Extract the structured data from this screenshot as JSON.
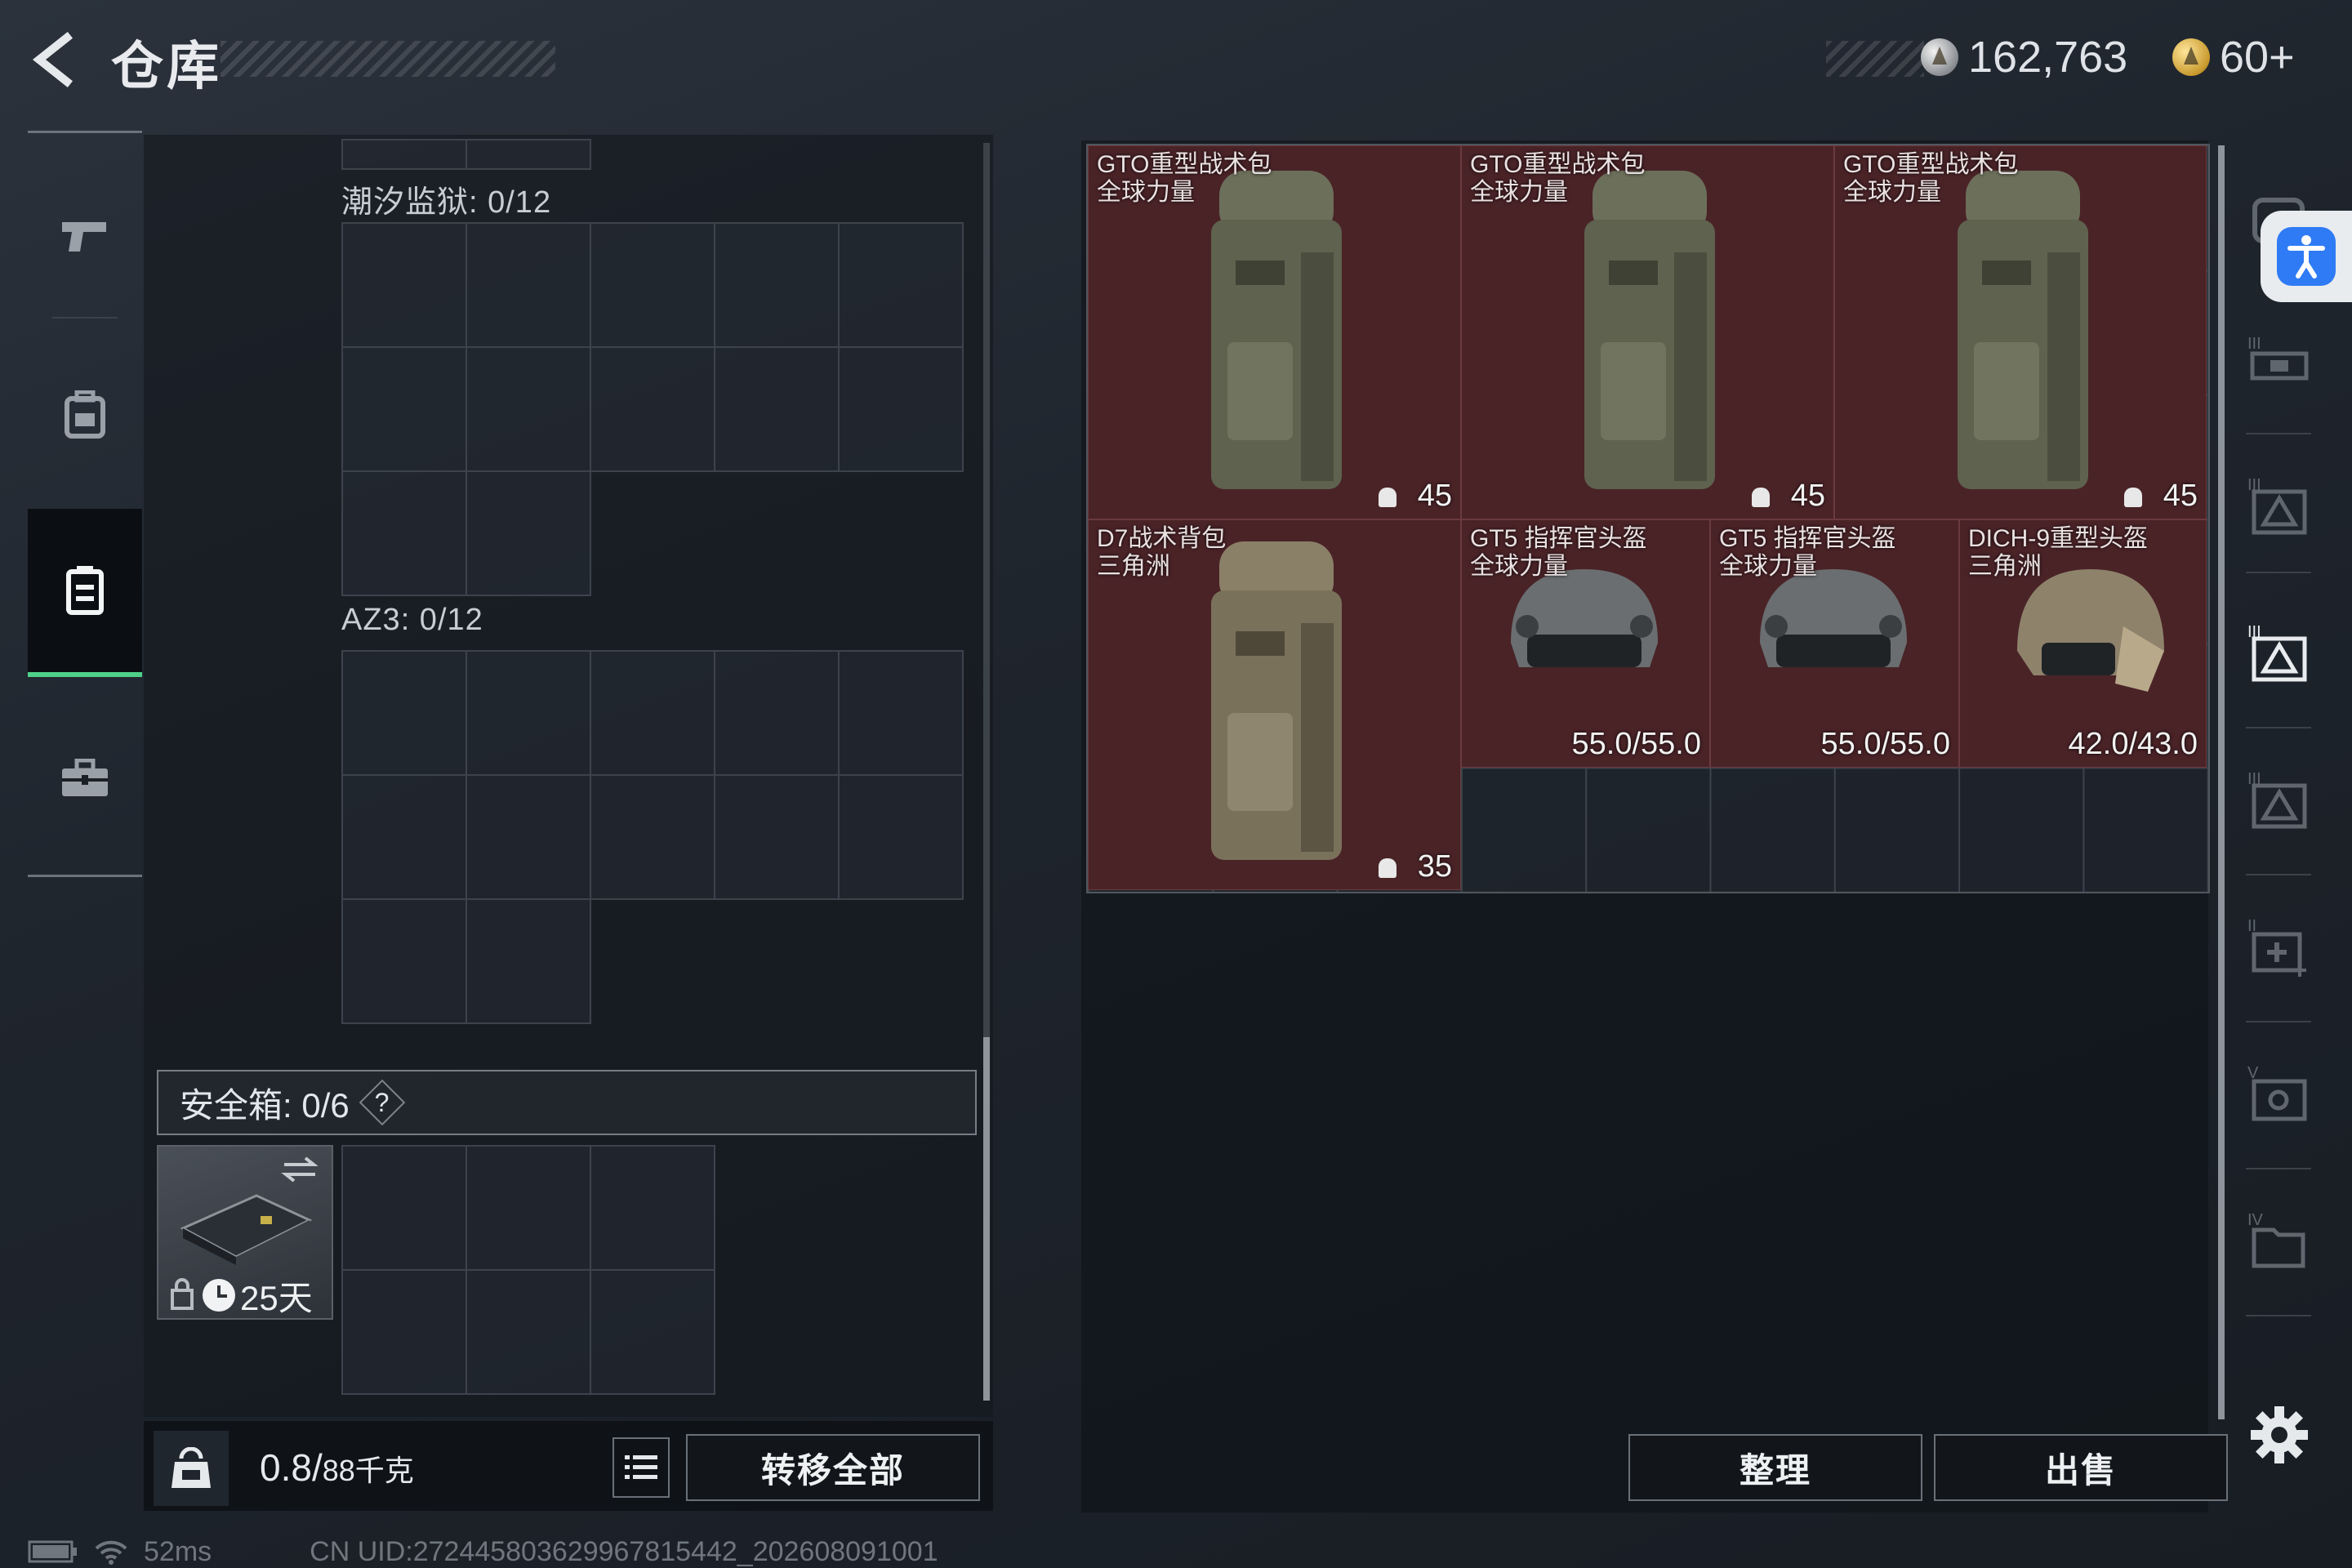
{
  "header": {
    "title": "仓库",
    "currency_silver": "162,763",
    "currency_gold": "60+"
  },
  "left_panel": {
    "section1_label": "潮汐监狱: 0/12",
    "section2_label": "AZ3: 0/12",
    "safebox_label": "安全箱:  0/6",
    "safebox_help": "?",
    "safe_item_days": "25天",
    "weight_value": "0.8/",
    "weight_unit": "88千克",
    "transfer_all": "转移全部"
  },
  "storage_items": [
    {
      "name": "GTO重型战术包\n全球力量",
      "value": "45"
    },
    {
      "name": "GTO重型战术包\n全球力量",
      "value": "45"
    },
    {
      "name": "GTO重型战术包\n全球力量",
      "value": "45"
    },
    {
      "name": "D7战术背包\n三角洲",
      "value": "35"
    },
    {
      "name": "GT5 指挥官头盔\n全球力量",
      "value": "55.0/55.0"
    },
    {
      "name": "GT5 指挥官头盔\n全球力量",
      "value": "55.0/55.0"
    },
    {
      "name": "DICH-9重型头盔\n三角洲",
      "value": "42.0/43.0"
    }
  ],
  "actions": {
    "sort": "整理",
    "sell": "出售"
  },
  "status": {
    "ping": "52ms",
    "uid": "CN UID:272445803629967815442_202608091001"
  },
  "colors": {
    "item_bg": "#4a2327",
    "selected_tab_accent": "#4fd08a",
    "accessibility_blue": "#2f7bf5"
  }
}
